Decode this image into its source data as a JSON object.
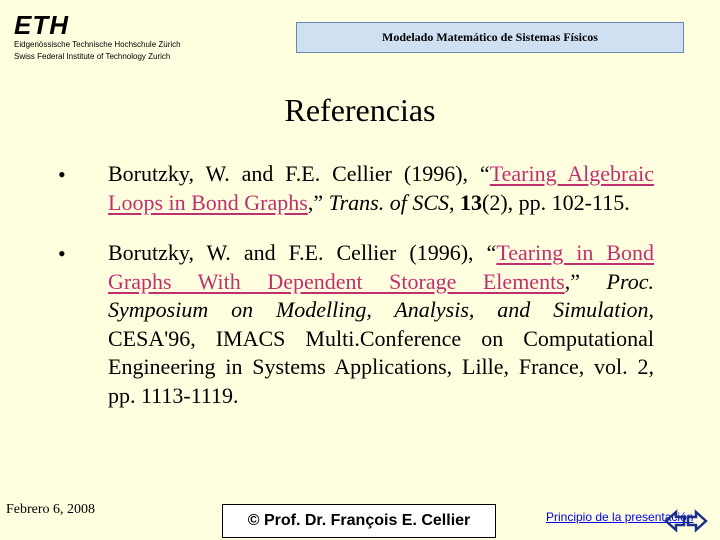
{
  "logo": {
    "mark": "ETH",
    "line1": "Eidgenössische Technische Hochschule Zürich",
    "line2": "Swiss Federal Institute of Technology Zurich"
  },
  "header": {
    "course_title": "Modelado Matemático de Sistemas Físicos"
  },
  "slide": {
    "title": "Referencias"
  },
  "references": [
    {
      "bullet": "•",
      "pre": "Borutzky, W. and F.E. Cellier (1996), “",
      "link": "Tearing Algebraic Loops in Bond Graphs",
      "mid": ",” ",
      "journal": "Trans. of SCS",
      "sep": ", ",
      "volume": "13",
      "post": "(2), pp. 102-115."
    },
    {
      "bullet": "•",
      "pre": "Borutzky, W. and F.E. Cellier (1996), “",
      "link": "Tearing in Bond Graphs With Dependent Storage Elements",
      "mid": ",” ",
      "proc": "Proc. Symposium on Modelling, Analysis, and Simulation",
      "post": ", CESA'96, IMACS Multi.Conference on Computational Engineering in Systems Applications, Lille, France, vol. 2, pp. 1113-1119."
    }
  ],
  "footer": {
    "date": "Febrero 6, 2008",
    "copyright": "© Prof. Dr. François E. Cellier",
    "start_link": "Principio de la presentación",
    "nav_icon": "double-arrow-icon"
  }
}
